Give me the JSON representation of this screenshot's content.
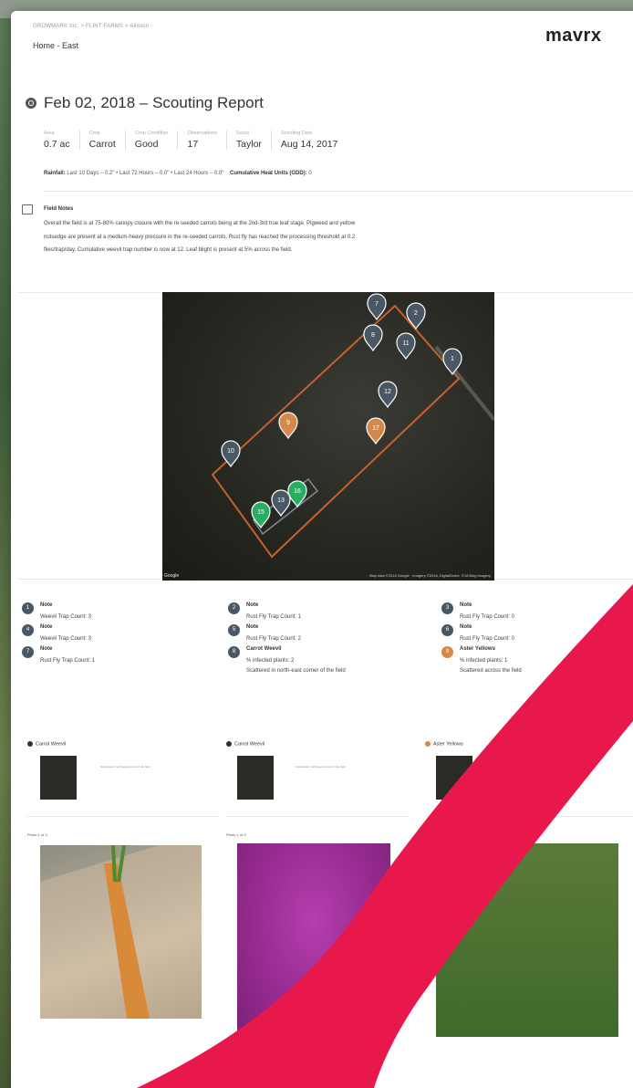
{
  "header": {
    "breadcrumb": "GROWMARK Inc. > FLINT FARMS > Alliston",
    "field_name": "Home - East",
    "logo_text": "mavrx"
  },
  "report": {
    "title": "Feb 02, 2018 – Scouting Report",
    "stats": [
      {
        "label": "Area",
        "value": "0.7 ac"
      },
      {
        "label": "Crop",
        "value": "Carrot"
      },
      {
        "label": "Crop Condition",
        "value": "Good"
      },
      {
        "label": "Observations",
        "value": "17"
      },
      {
        "label": "Scout",
        "value": "Taylor"
      },
      {
        "label": "Scouting Date",
        "value": "Aug 14, 2017"
      }
    ],
    "rainfall_label": "Rainfall:",
    "rainfall_text": "Last 10 Days – 0.2\" • Last 72 Hours – 0.0\" • Last 24 Hours – 0.0\"",
    "gdd_label": "Cumulative Heat Units (GDD):",
    "gdd_value": "0"
  },
  "field_notes": {
    "title": "Field Notes",
    "lines": [
      "Overall the field is at 75-80% canopy closure with the re-seeded carrots being at the 2nd-3rd true leaf stage. Pigweed and yellow",
      "nutsedge are present at a medium-heavy pressure in the re-seeded carrots. Rust fly has reached the processing threshold at 0.2",
      "flies/trap/day. Cumulative weevil trap number is now at 12. Leaf blight is present at 5% across the field."
    ]
  },
  "map": {
    "google_label": "Google",
    "credit": "Map data ©2018 Google · Imagery ©2018, DigitalGlobe, ©18 Bing Imagery",
    "pins": [
      {
        "label": "7",
        "color": "#4a5866"
      },
      {
        "label": "2",
        "color": "#4a5866"
      },
      {
        "label": "8",
        "color": "#4a5866"
      },
      {
        "label": "11",
        "color": "#4a5866"
      },
      {
        "label": "1",
        "color": "#4a5866"
      },
      {
        "label": "12",
        "color": "#4a5866"
      },
      {
        "label": "9",
        "color": "#d4884a"
      },
      {
        "label": "17",
        "color": "#d4884a"
      },
      {
        "label": "10",
        "color": "#4a5866"
      },
      {
        "label": "16",
        "color": "#27ae60"
      },
      {
        "label": "13",
        "color": "#4a5866"
      },
      {
        "label": "15",
        "color": "#27ae60"
      }
    ]
  },
  "observations": [
    {
      "num": "1",
      "title": "Note",
      "details": [
        "Weevil Trap Count: 3"
      ],
      "color": "#4a5866"
    },
    {
      "num": "2",
      "title": "Note",
      "details": [
        "Rust Fly Trap Count: 1"
      ],
      "color": "#4a5866"
    },
    {
      "num": "3",
      "title": "Note",
      "details": [
        "Rust Fly Trap Count: 0"
      ],
      "color": "#4a5866"
    },
    {
      "num": "4",
      "title": "Note",
      "details": [
        "Weevil Trap Count: 3"
      ],
      "color": "#4a5866"
    },
    {
      "num": "5",
      "title": "Note",
      "details": [
        "Rust Fly Trap Count: 2"
      ],
      "color": "#4a5866"
    },
    {
      "num": "6",
      "title": "Note",
      "details": [
        "Rust Fly Trap Count: 0"
      ],
      "color": "#4a5866"
    },
    {
      "num": "7",
      "title": "Note",
      "details": [
        "Rust Fly Trap Count: 1"
      ],
      "color": "#4a5866"
    },
    {
      "num": "8",
      "title": "Carrot Weevil",
      "details": [
        "% infected plants: 2",
        "Scattered in north-east corner of the field"
      ],
      "color": "#4a5866"
    },
    {
      "num": "9",
      "title": "Aster Yellows",
      "details": [
        "% infected plants: 1",
        "Scattered across the field"
      ],
      "color": "#d4884a"
    }
  ],
  "cards": [
    {
      "title": "Carrot Weevil",
      "caption": "Scattered in north-east corner of the field",
      "photo_label": "Photo 1 of 3"
    },
    {
      "title": "Carrot Weevil",
      "caption": "Scattered in north-east corner of the field",
      "photo_label": "Photo 1 of 3"
    },
    {
      "title": "Aster Yellows",
      "caption": "Scattered across the field",
      "photo_label": "Photo 1 of 1"
    }
  ],
  "colors": {
    "accent_red": "#e8184d",
    "pin_grey": "#4a5866",
    "pin_orange": "#d4884a",
    "pin_green": "#27ae60",
    "field_outline": "#c8612a"
  }
}
